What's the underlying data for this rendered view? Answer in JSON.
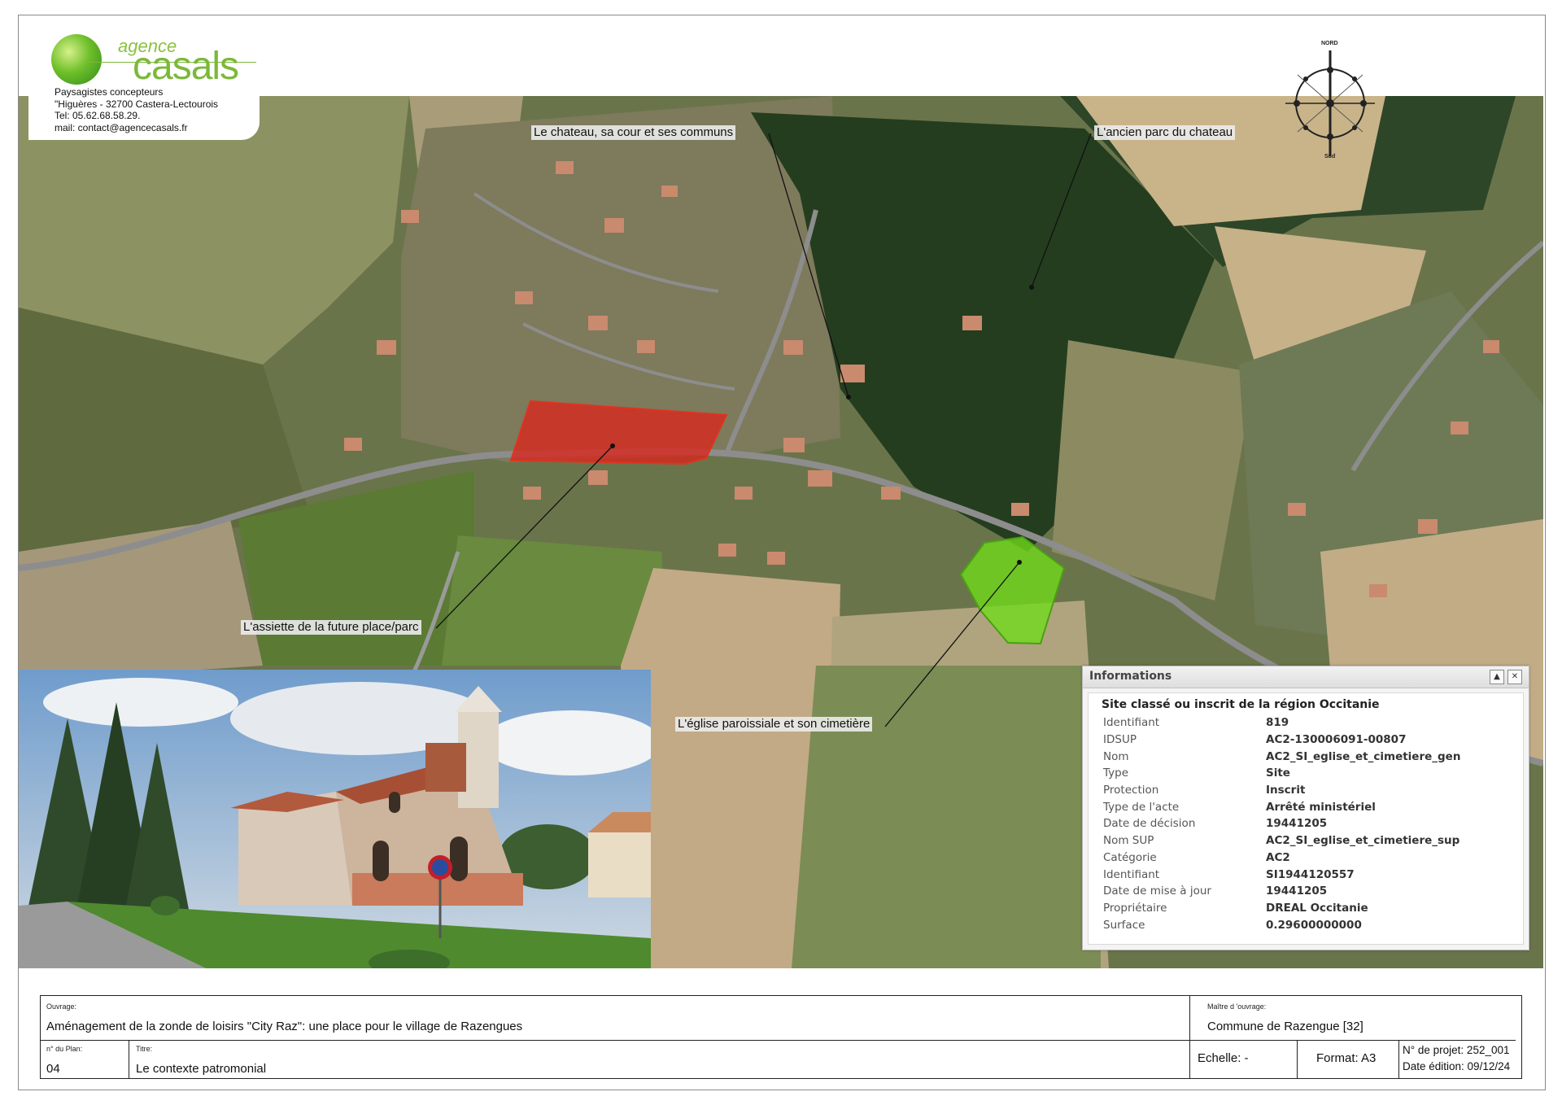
{
  "agency": {
    "logo_text_small": "agence",
    "logo_text_big": "casals",
    "lines": [
      "Paysagistes concepteurs",
      "\"Higuères - 32700 Castera-Lectourois",
      "Tel: 05.62.68.58.29.",
      "mail: contact@agencecasals.fr"
    ]
  },
  "compass": {
    "north": "NORD",
    "south": "Sud"
  },
  "callouts": {
    "chateau": "Le chateau, sa cour et ses communs",
    "parc": "L'ancien parc du chateau",
    "assiette": "L'assiette de la future place/parc",
    "eglise": "L'église paroissiale et son cimetière"
  },
  "info_panel": {
    "header": "Informations",
    "title": "Site classé ou inscrit de la région Occitanie",
    "rows": [
      {
        "key": "Identifiant",
        "value": "819"
      },
      {
        "key": "IDSUP",
        "value": "AC2-130006091-00807"
      },
      {
        "key": "Nom",
        "value": "AC2_SI_eglise_et_cimetiere_gen"
      },
      {
        "key": "Type",
        "value": "Site"
      },
      {
        "key": "Protection",
        "value": "Inscrit"
      },
      {
        "key": "Type de l'acte",
        "value": "Arrêté ministériel"
      },
      {
        "key": "Date de décision",
        "value": "19441205"
      },
      {
        "key": "Nom SUP",
        "value": "AC2_SI_eglise_et_cimetiere_sup"
      },
      {
        "key": "Catégorie",
        "value": "AC2"
      },
      {
        "key": "Identifiant",
        "value": "SI1944120557"
      },
      {
        "key": "Date de mise à jour",
        "value": "19441205"
      },
      {
        "key": "Propriétaire",
        "value": "DREAL Occitanie"
      },
      {
        "key": "Surface",
        "value": "0.29600000000"
      }
    ]
  },
  "title_block": {
    "ouvrage_label": "Ouvrage:",
    "ouvrage": "Aménagement de la zonde de loisirs \"City Raz\": une place pour le village de Razengues",
    "maitre_label": "Maître d 'ouvrage:",
    "maitre": "Commune de Razengue [32]",
    "plan_label": "n° du Plan:",
    "plan": "04",
    "titre_label": "Titre:",
    "titre": "Le contexte patromonial",
    "echelle": "Echelle: -",
    "format": "Format: A3",
    "projet": "N° de projet: 252_001",
    "date": "Date édition: 09/12/24"
  },
  "colors": {
    "red_zone": "#d9251c",
    "green_zone": "#6fdc1a",
    "field_light": "#c8b48a",
    "forest": "#243d1f",
    "road": "#8d8d8d"
  }
}
